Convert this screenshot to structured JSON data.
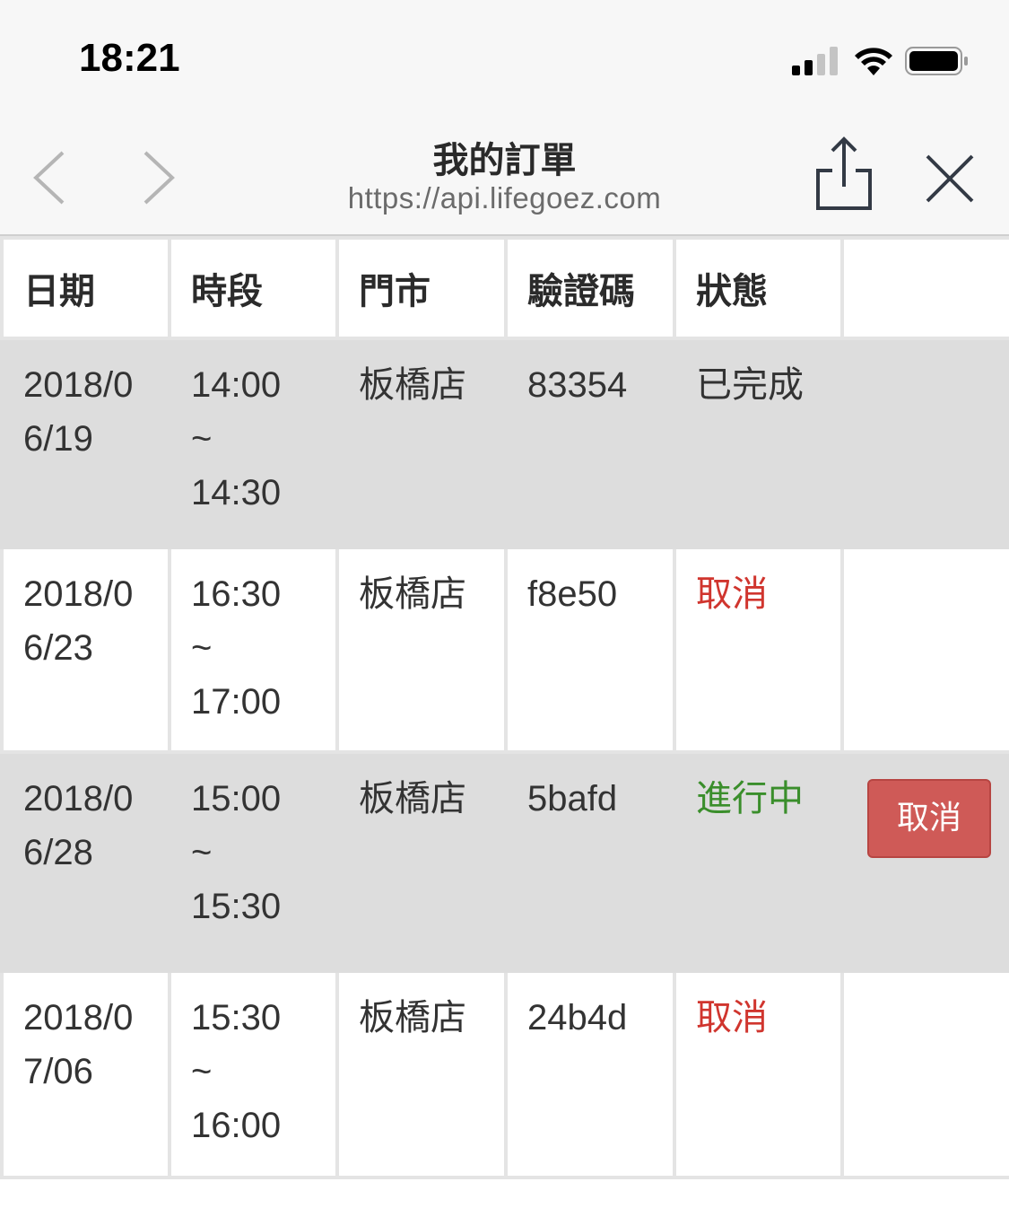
{
  "status_bar": {
    "time": "18:21"
  },
  "nav": {
    "title": "我的訂單",
    "url": "https://api.lifegoez.com"
  },
  "table": {
    "headers": [
      "日期",
      "時段",
      "門市",
      "驗證碼",
      "狀態",
      ""
    ],
    "rows": [
      {
        "date": "2018/06/19",
        "time_start": "14:00",
        "time_sep": "~",
        "time_end": "14:30",
        "store": "板橋店",
        "code": "83354",
        "status": "已完成",
        "status_color": "#333333",
        "action": ""
      },
      {
        "date": "2018/06/23",
        "time_start": "16:30",
        "time_sep": "~",
        "time_end": "17:00",
        "store": "板橋店",
        "code": "f8e50",
        "status": "取消",
        "status_color": "#d0352e",
        "action": ""
      },
      {
        "date": "2018/06/28",
        "time_start": "15:00",
        "time_sep": "~",
        "time_end": "15:30",
        "store": "板橋店",
        "code": "5bafd",
        "status": "進行中",
        "status_color": "#3a8e2b",
        "action": "取消"
      },
      {
        "date": "2018/07/06",
        "time_start": "15:30",
        "time_sep": "~",
        "time_end": "16:00",
        "store": "板橋店",
        "code": "24b4d",
        "status": "取消",
        "status_color": "#d0352e",
        "action": ""
      }
    ]
  },
  "colors": {
    "cancel_button": "#cf5a57",
    "row_alt": "#dddddd"
  }
}
